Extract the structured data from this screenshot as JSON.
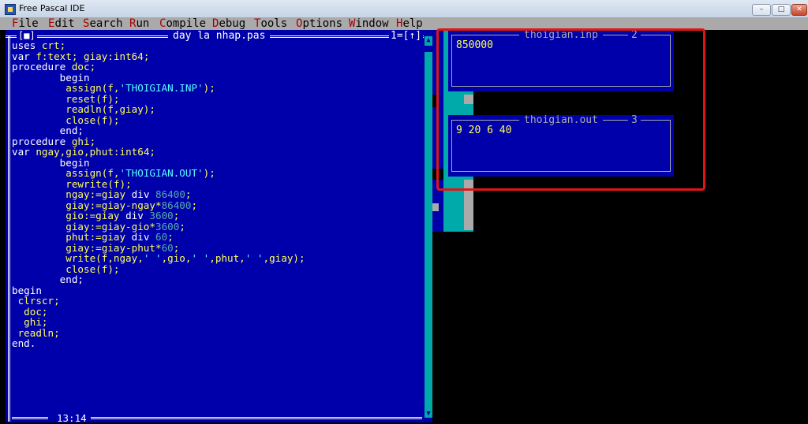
{
  "window": {
    "title": "Free Pascal IDE",
    "minimize": "–",
    "maximize": "□",
    "close": "✕"
  },
  "menu": [
    {
      "hotkey": "F",
      "rest": "ile"
    },
    {
      "hotkey": "E",
      "rest": "dit"
    },
    {
      "hotkey": "S",
      "rest": "earch"
    },
    {
      "hotkey": "R",
      "rest": "un"
    },
    {
      "hotkey": "C",
      "rest": "ompile"
    },
    {
      "hotkey": "D",
      "rest": "ebug"
    },
    {
      "hotkey": "T",
      "rest": "ools"
    },
    {
      "hotkey": "O",
      "rest": "ptions"
    },
    {
      "hotkey": "W",
      "rest": "indow"
    },
    {
      "hotkey": "H",
      "rest": "elp"
    }
  ],
  "editor": {
    "filename": "day la nhap.pas",
    "window_number": "1=[↑]",
    "close_box": "[■]",
    "cursor_position": "13:14",
    "lines": [
      [
        [
          "uses ",
          "kw"
        ],
        [
          "crt;",
          "text"
        ]
      ],
      [
        [
          "var ",
          "kw"
        ],
        [
          "f:text; giay:int64;",
          "text"
        ]
      ],
      [
        [
          "procedure ",
          "kw"
        ],
        [
          "doc;",
          "text"
        ]
      ],
      [
        [
          "        begin",
          "kw"
        ]
      ],
      [
        [
          "         assign(f,",
          "text"
        ],
        [
          "'THOIGIAN.INP'",
          "str"
        ],
        [
          ");",
          "text"
        ]
      ],
      [
        [
          "         reset(f);",
          "text"
        ]
      ],
      [
        [
          "         readln(f,giay);",
          "text"
        ]
      ],
      [
        [
          "         close(f);",
          "text"
        ]
      ],
      [
        [
          "        end;",
          "kw"
        ]
      ],
      [
        [
          "procedure ",
          "kw"
        ],
        [
          "ghi;",
          "text"
        ]
      ],
      [
        [
          "var ",
          "kw"
        ],
        [
          "ngay,gio,phut:int64;",
          "text"
        ]
      ],
      [
        [
          "        begin",
          "kw"
        ]
      ],
      [
        [
          "         assign(f,",
          "text"
        ],
        [
          "'THOIGIAN.OUT'",
          "str"
        ],
        [
          ");",
          "text"
        ]
      ],
      [
        [
          "         rewrite(f);",
          "text"
        ]
      ],
      [
        [
          "         ngay:=giay ",
          "text"
        ],
        [
          "div ",
          "kw"
        ],
        [
          "86400",
          "num"
        ],
        [
          ";",
          "text"
        ]
      ],
      [
        [
          "         giay:=giay-ngay*",
          "text"
        ],
        [
          "86400",
          "num"
        ],
        [
          ";",
          "text"
        ]
      ],
      [
        [
          "         gio:=giay ",
          "text"
        ],
        [
          "div ",
          "kw"
        ],
        [
          "3600",
          "num"
        ],
        [
          ";",
          "text"
        ]
      ],
      [
        [
          "         giay:=giay-gio*",
          "text"
        ],
        [
          "3600",
          "num"
        ],
        [
          ";",
          "text"
        ]
      ],
      [
        [
          "         phut:=giay ",
          "text"
        ],
        [
          "div ",
          "kw"
        ],
        [
          "60",
          "num"
        ],
        [
          ";",
          "text"
        ]
      ],
      [
        [
          "         giay:=giay-phut*",
          "text"
        ],
        [
          "60",
          "num"
        ],
        [
          ";",
          "text"
        ]
      ],
      [
        [
          "         write(f,ngay,",
          "text"
        ],
        [
          "' '",
          "str"
        ],
        [
          ",gio,",
          "text"
        ],
        [
          "' '",
          "str"
        ],
        [
          ",phut,",
          "text"
        ],
        [
          "' '",
          "str"
        ],
        [
          ",giay);",
          "text"
        ]
      ],
      [
        [
          "         close(f);",
          "text"
        ]
      ],
      [
        [
          "        end;",
          "kw"
        ]
      ],
      [
        [
          "begin",
          "kw"
        ]
      ],
      [
        [
          " clrscr;",
          "text"
        ]
      ],
      [
        [
          "  doc;",
          "text"
        ]
      ],
      [
        [
          "  ghi;",
          "text"
        ]
      ],
      [
        [
          " readln;",
          "text"
        ]
      ],
      [
        [
          "end.",
          "kw"
        ]
      ]
    ]
  },
  "input_window": {
    "title": "thoigian.inp",
    "number": "2",
    "content": "850000"
  },
  "output_window": {
    "title": "thoigian.out",
    "number": "3",
    "content": "9 20 6 40"
  }
}
